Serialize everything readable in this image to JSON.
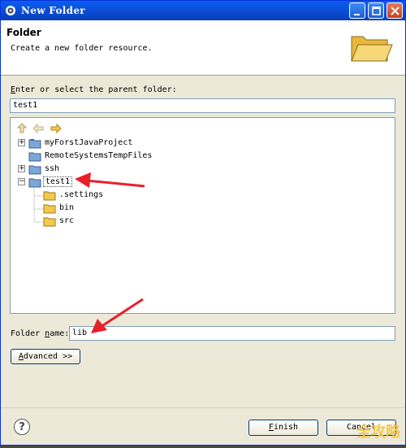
{
  "window": {
    "title": "New Folder"
  },
  "banner": {
    "title": "Folder",
    "description": "Create a new folder resource."
  },
  "parent": {
    "label_prefix": "E",
    "label_rest": "nter or select the parent folder:",
    "value": "test1"
  },
  "tree": {
    "items": [
      {
        "label": "myForstJavaProject",
        "expandable": true,
        "expander": "+"
      },
      {
        "label": "RemoteSystemsTempFiles",
        "expandable": false,
        "expander": ""
      },
      {
        "label": "ssh",
        "expandable": true,
        "expander": "+"
      },
      {
        "label": "test1",
        "expandable": true,
        "expander": "−",
        "selected": true
      },
      {
        "label": ".settings"
      },
      {
        "label": "bin"
      },
      {
        "label": "src"
      }
    ]
  },
  "folder_name": {
    "label_pre": "Folder ",
    "label_u": "n",
    "label_post": "ame:",
    "value": "lib"
  },
  "advanced": {
    "label_u": "A",
    "label_rest": "dvanced >>"
  },
  "footer": {
    "help": "?",
    "finish_u": "F",
    "finish_rest": "inish",
    "cancel": "Cancel"
  },
  "watermark": "全攻略",
  "colors": {
    "titlebar": "#0b4cd3",
    "annotation_arrow": "#e8202a",
    "watermark": "#f3c542",
    "folder": "#f2c94c"
  }
}
